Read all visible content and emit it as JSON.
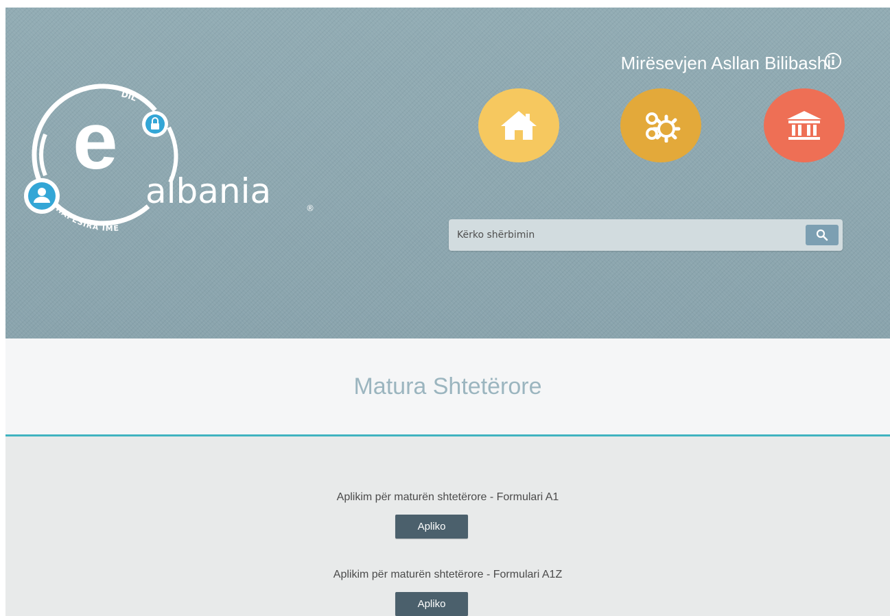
{
  "header": {
    "logo": {
      "letter": "e",
      "wordmark": "albania",
      "registered": "®",
      "ring_top": "DIL",
      "ring_bottom": "HAPËSIRA IME"
    },
    "welcome_text": "Mirësevjen Asllan Bilibashi",
    "icons": {
      "info": "info-icon",
      "home": "home-icon",
      "gears": "gears-icon",
      "institution": "institution-icon",
      "search": "search-icon"
    },
    "colors": {
      "home": "#f6c85f",
      "gears": "#e3a93a",
      "institution": "#ee6f55",
      "accent_line": "#3fb3c0",
      "button": "#4b606c"
    },
    "search": {
      "placeholder": "Kërko shërbimin",
      "value": ""
    }
  },
  "page": {
    "title": "Matura Shtetërore"
  },
  "services": [
    {
      "label": "Aplikim për maturën shtetërore - Formulari A1",
      "button": "Apliko"
    },
    {
      "label": "Aplikim për maturën shtetërore - Formulari A1Z",
      "button": "Apliko"
    }
  ]
}
